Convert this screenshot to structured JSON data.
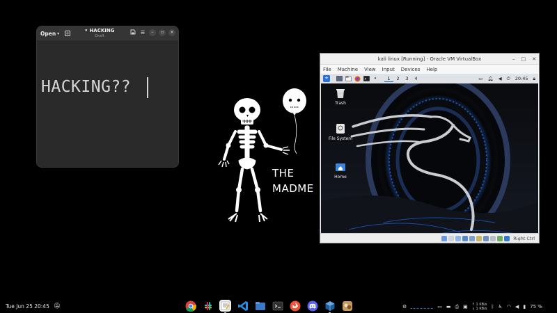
{
  "editor": {
    "open_label": "Open",
    "title": "• HACKING",
    "subtitle": "Draft",
    "content": "HACKING??"
  },
  "wallpaper": {
    "line1": "THE",
    "line2": "MADME"
  },
  "virtualbox": {
    "title": "kali linux [Running] - Oracle VM VirtualBox",
    "menu": [
      "File",
      "Machine",
      "View",
      "Input",
      "Devices",
      "Help"
    ],
    "status_hostkey": "Right Ctrl"
  },
  "kali": {
    "workspaces": [
      "1",
      "2",
      "3",
      "4"
    ],
    "active_workspace": "1",
    "clock": "20:45",
    "desktop_icons": [
      {
        "label": "Trash",
        "icon": "trash-icon"
      },
      {
        "label": "File System",
        "icon": "drive-icon"
      },
      {
        "label": "Home",
        "icon": "home-folder-icon"
      }
    ]
  },
  "taskbar": {
    "datetime": "Tue Jun 25  20:45",
    "apps": [
      {
        "name": "chrome",
        "icon": "chrome-icon",
        "color": "#db4437",
        "active": false
      },
      {
        "name": "slack",
        "icon": "slack-icon",
        "color": "#ffffff",
        "active": false
      },
      {
        "name": "text-editor",
        "icon": "text-editor-icon",
        "color": "#e7e7e7",
        "active": true
      },
      {
        "name": "vscode",
        "icon": "vscode-icon",
        "color": "#2b8fe6",
        "active": false
      },
      {
        "name": "files",
        "icon": "files-icon",
        "color": "#3a78c8",
        "active": false
      },
      {
        "name": "terminal",
        "icon": "terminal-icon",
        "color": "#333333",
        "active": false
      },
      {
        "name": "swift",
        "icon": "swift-icon",
        "color": "#f05138",
        "active": false
      },
      {
        "name": "discord",
        "icon": "discord-icon",
        "color": "#5865f2",
        "active": false
      },
      {
        "name": "virtualbox",
        "icon": "virtualbox-icon",
        "color": "#1b5e9e",
        "active": true
      },
      {
        "name": "game",
        "icon": "game-icon",
        "color": "#c59a5a",
        "active": false
      }
    ],
    "net_up": "↑ 1 KB/s",
    "net_down": "↓ 1 KB/s",
    "battery": "75 %"
  }
}
